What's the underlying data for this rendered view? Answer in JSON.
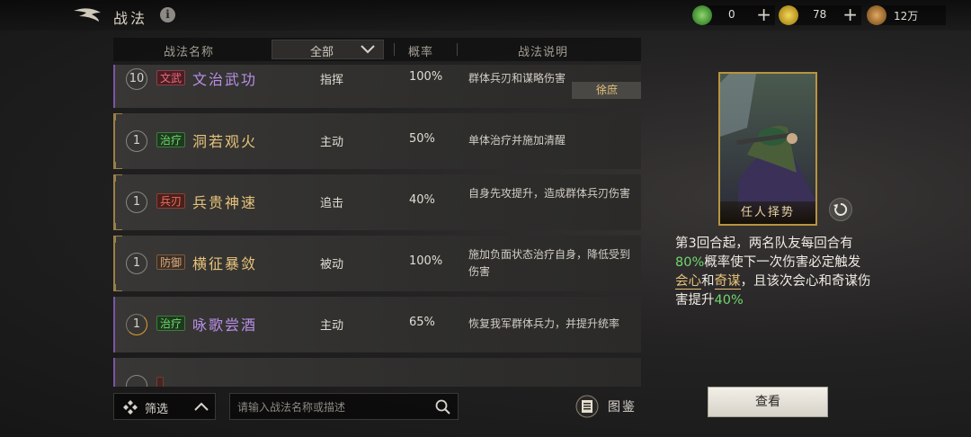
{
  "header": {
    "title": "战法",
    "currencies": [
      {
        "icon": "jade-coin-icon",
        "amount": "0",
        "color": "#5aa84a"
      },
      {
        "icon": "gold-coin-icon",
        "amount": "78",
        "color": "#d9b93a"
      },
      {
        "icon": "copper-coin-icon",
        "amount": "12万",
        "color": "#c08a4a"
      }
    ]
  },
  "table": {
    "col_name": "战法名称",
    "filter_value": "全部",
    "col_rate": "概率",
    "col_desc": "战法说明"
  },
  "tactics": [
    {
      "level": "10",
      "tag": "文武",
      "name": "文治武功",
      "type": "指挥",
      "rate": "100%",
      "desc": "群体兵刃和谋略伤害",
      "owner": "徐庶"
    },
    {
      "level": "1",
      "tag": "治疗",
      "name": "洞若观火",
      "type": "主动",
      "rate": "50%",
      "desc": "单体治疗并施加清醒"
    },
    {
      "level": "1",
      "tag": "兵刃",
      "name": "兵贵神速",
      "type": "追击",
      "rate": "40%",
      "desc": "自身先攻提升，造成群体兵刃伤害"
    },
    {
      "level": "1",
      "tag": "防御",
      "name": "横征暴敛",
      "type": "被动",
      "rate": "100%",
      "desc": "施加负面状态治疗自身，降低受到伤害"
    },
    {
      "level": "1",
      "tag": "治疗",
      "name": "咏歌尝酒",
      "type": "主动",
      "rate": "65%",
      "desc": "恢复我军群体兵力，并提升统率"
    }
  ],
  "bottom": {
    "filter_label": "筛选",
    "search_placeholder": "请输入战法名称或描述",
    "catalog_label": "图鉴"
  },
  "detail": {
    "card_title": "任人择势",
    "desc_1": "第3回合起，两名队友每回合有",
    "desc_2": "80%",
    "desc_3": "概率使下一次伤害必定触发",
    "desc_4": "会心",
    "desc_5": "和",
    "desc_6": "奇谋",
    "desc_7": "，且该次会心和奇谋伤害提升",
    "desc_8": "40%",
    "view_label": "查看"
  }
}
